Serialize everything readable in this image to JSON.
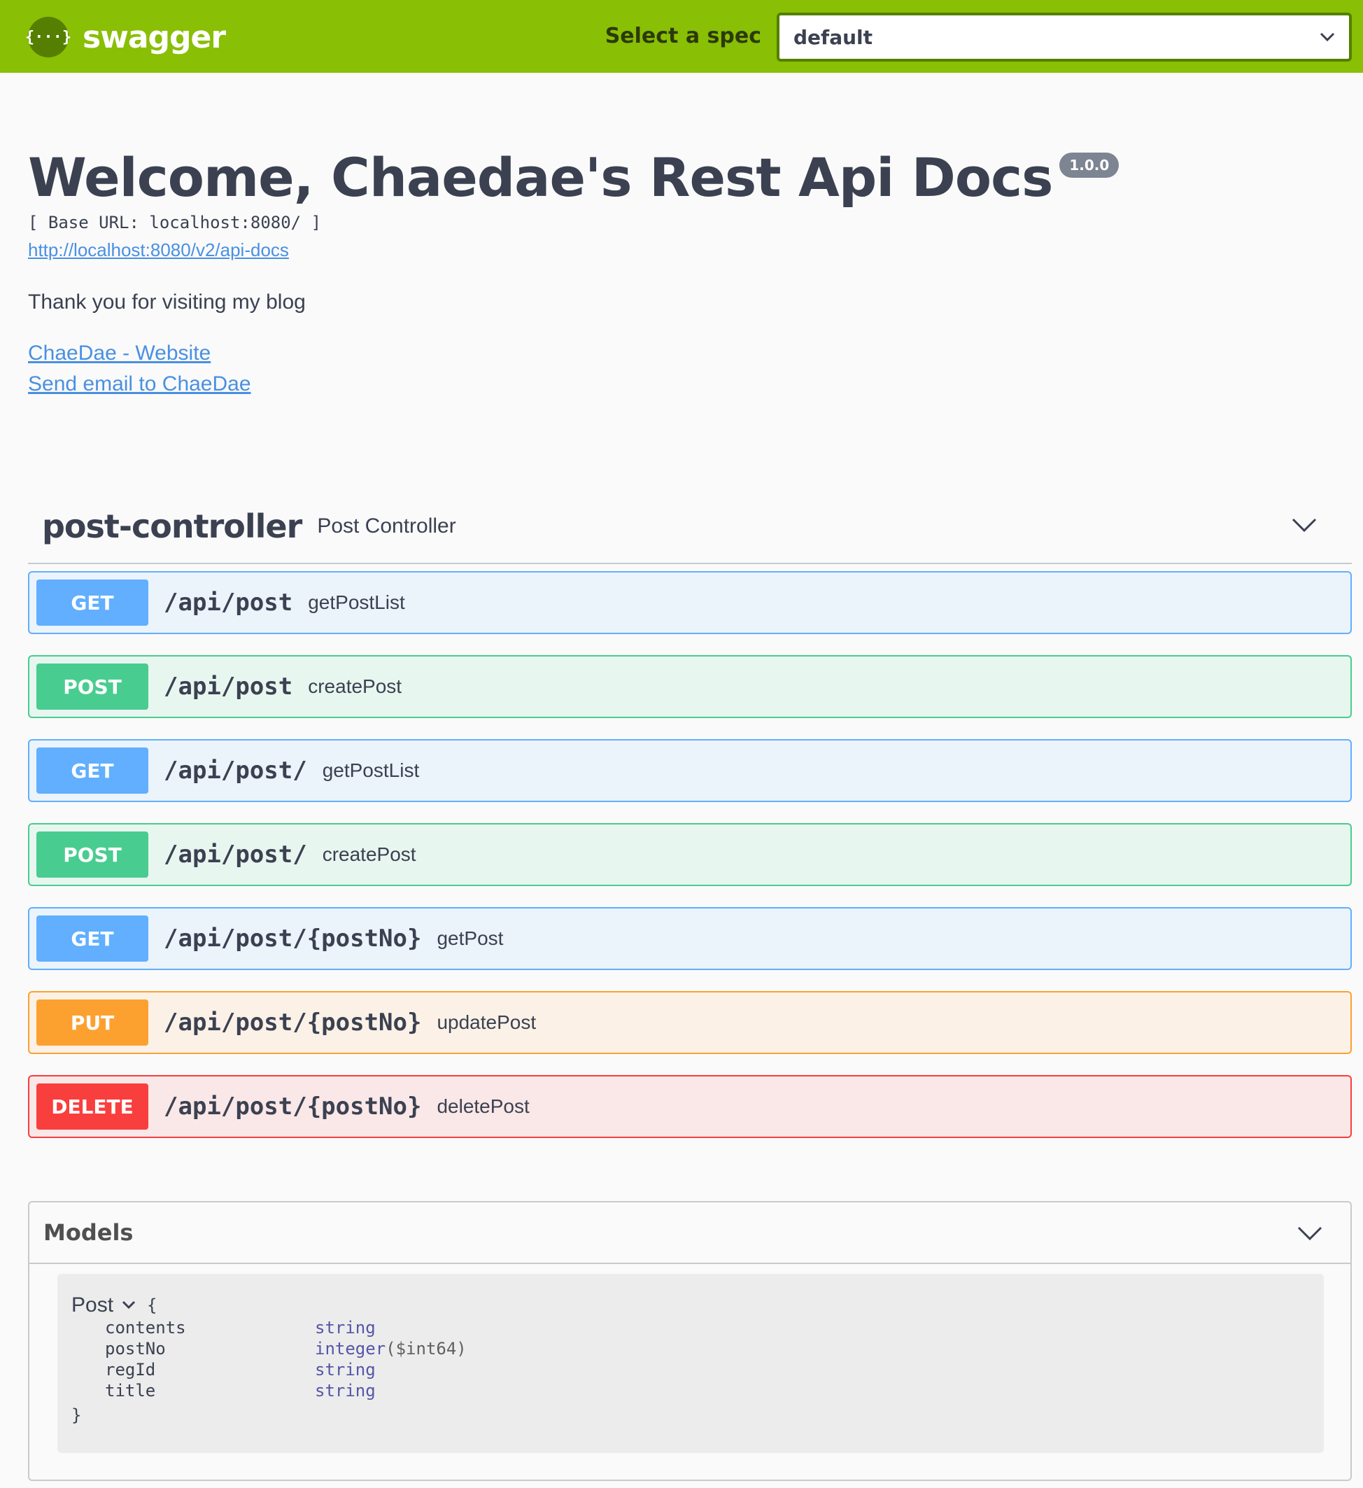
{
  "topbar": {
    "logo_glyph": "{···}",
    "logo_text": "swagger",
    "spec_label": "Select a spec",
    "spec_selected": "default",
    "brand_color": "#89bf04"
  },
  "info": {
    "title": "Welcome, Chaedae's Rest Api Docs",
    "version": "1.0.0",
    "base_url": "[ Base URL: localhost:8080/ ]",
    "api_docs_url": "http://localhost:8080/v2/api-docs",
    "description": "Thank you for visiting my blog",
    "website_link": "ChaeDae - Website",
    "email_link": "Send email to ChaeDae"
  },
  "tag": {
    "name": "post-controller",
    "description": "Post Controller"
  },
  "operations": [
    {
      "method": "GET",
      "path": "/api/post",
      "summary": "getPostList"
    },
    {
      "method": "POST",
      "path": "/api/post",
      "summary": "createPost"
    },
    {
      "method": "GET",
      "path": "/api/post/",
      "summary": "getPostList"
    },
    {
      "method": "POST",
      "path": "/api/post/",
      "summary": "createPost"
    },
    {
      "method": "GET",
      "path": "/api/post/{postNo}",
      "summary": "getPost"
    },
    {
      "method": "PUT",
      "path": "/api/post/{postNo}",
      "summary": "updatePost"
    },
    {
      "method": "DELETE",
      "path": "/api/post/{postNo}",
      "summary": "deletePost"
    }
  ],
  "models": {
    "title": "Models",
    "model_name": "Post",
    "open_brace": "{",
    "close_brace": "}",
    "properties": [
      {
        "name": "contents",
        "type": "string",
        "format": ""
      },
      {
        "name": "postNo",
        "type": "integer",
        "format": "($int64)"
      },
      {
        "name": "regId",
        "type": "string",
        "format": ""
      },
      {
        "name": "title",
        "type": "string",
        "format": ""
      }
    ]
  },
  "method_colors": {
    "GET": "#61affe",
    "POST": "#49cc90",
    "PUT": "#fca130",
    "DELETE": "#f93e3e"
  }
}
